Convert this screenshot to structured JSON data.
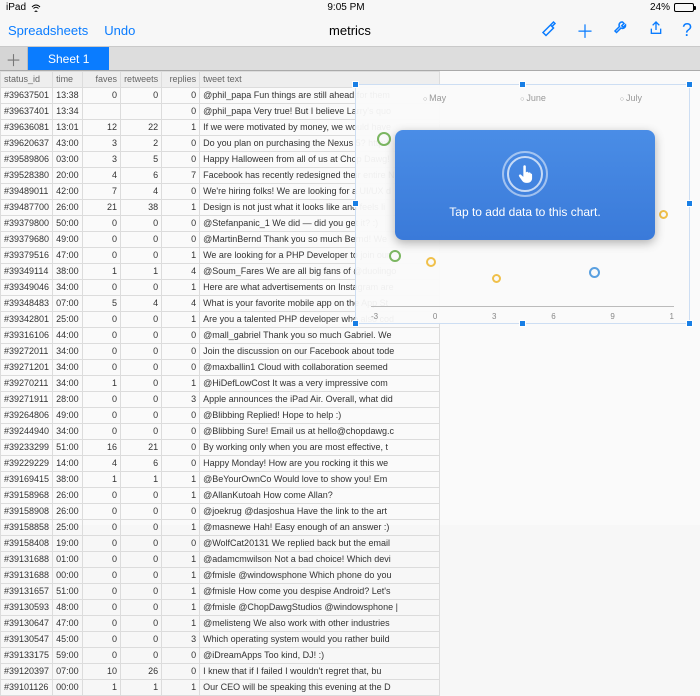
{
  "statusbar": {
    "device": "iPad",
    "time": "9:05 PM",
    "battery": "24%"
  },
  "toolbar": {
    "back": "Spreadsheets",
    "undo": "Undo",
    "title": "metrics"
  },
  "tabs": {
    "sheet1": "Sheet 1"
  },
  "headers": {
    "id": "status_id",
    "time": "time",
    "faves": "faves",
    "retweets": "retweets",
    "replies": "replies",
    "text": "tweet text"
  },
  "rows": [
    {
      "id": "#39637501",
      "time": "13:38",
      "f": "0",
      "r": "0",
      "rp": "0",
      "t": "@phil_papa Fun things are still ahead for them"
    },
    {
      "id": "#39637401",
      "time": "13:34",
      "f": "",
      "r": "",
      "rp": "0",
      "t": "@phil_papa Very true! But I believe Larry's quo"
    },
    {
      "id": "#39636081",
      "time": "13:01",
      "f": "12",
      "r": "22",
      "rp": "1",
      "t": "If we were motivated by money, we would have"
    },
    {
      "id": "#39620637",
      "time": "43:00",
      "f": "3",
      "r": "2",
      "rp": "0",
      "t": "Do you plan on purchasing the Nexus 5? http://"
    },
    {
      "id": "#39589806",
      "time": "03:00",
      "f": "3",
      "r": "5",
      "rp": "0",
      "t": "Happy Halloween from all of us at Chop Dawg!"
    },
    {
      "id": "#39528380",
      "time": "20:00",
      "f": "4",
      "r": "6",
      "rp": "7",
      "t": "Facebook has recently redesigned their entire N"
    },
    {
      "id": "#39489011",
      "time": "42:00",
      "f": "7",
      "r": "4",
      "rp": "0",
      "t": "We're hiring folks! We are looking for a UI/UX d"
    },
    {
      "id": "#39487700",
      "time": "26:00",
      "f": "21",
      "r": "38",
      "rp": "1",
      "t": "Design is not just what it looks like and feels li"
    },
    {
      "id": "#39379800",
      "time": "50:00",
      "f": "0",
      "r": "0",
      "rp": "0",
      "t": "@Stefanpanic_1 We did — did you get it? :)"
    },
    {
      "id": "#39379680",
      "time": "49:00",
      "f": "0",
      "r": "0",
      "rp": "0",
      "t": "@MartinBernd Thank you so much Bernd! We"
    },
    {
      "id": "#39379516",
      "time": "47:00",
      "f": "0",
      "r": "0",
      "rp": "1",
      "t": "We are looking for a PHP Developer to join our"
    },
    {
      "id": "#39349114",
      "time": "38:00",
      "f": "1",
      "r": "1",
      "rp": "4",
      "t": "@Soum_Fares We are all big fans of @duolingo"
    },
    {
      "id": "#39349046",
      "time": "34:00",
      "f": "0",
      "r": "0",
      "rp": "1",
      "t": "Here are what advertisements on Instagram are"
    },
    {
      "id": "#39348483",
      "time": "07:00",
      "f": "5",
      "r": "4",
      "rp": "4",
      "t": "What is your favorite mobile app on the App St"
    },
    {
      "id": "#39342801",
      "time": "25:00",
      "f": "0",
      "r": "0",
      "rp": "1",
      "t": "Are you a talented PHP developer who also cod"
    },
    {
      "id": "#39316106",
      "time": "44:00",
      "f": "0",
      "r": "0",
      "rp": "0",
      "t": "@mall_gabriel Thank you so much Gabriel. We"
    },
    {
      "id": "#39272011",
      "time": "34:00",
      "f": "0",
      "r": "0",
      "rp": "0",
      "t": "Join the discussion on our Facebook about tode"
    },
    {
      "id": "#39271201",
      "time": "34:00",
      "f": "0",
      "r": "0",
      "rp": "0",
      "t": "@maxballin1 Cloud with collaboration seemed"
    },
    {
      "id": "#39270211",
      "time": "34:00",
      "f": "1",
      "r": "0",
      "rp": "1",
      "t": "@HiDefLowCost It was a very impressive com"
    },
    {
      "id": "#39271911",
      "time": "28:00",
      "f": "0",
      "r": "0",
      "rp": "3",
      "t": "Apple announces the iPad Air. Overall, what did"
    },
    {
      "id": "#39264806",
      "time": "49:00",
      "f": "0",
      "r": "0",
      "rp": "0",
      "t": "@Blibbing Replied! Hope to help :)"
    },
    {
      "id": "#39244940",
      "time": "34:00",
      "f": "0",
      "r": "0",
      "rp": "0",
      "t": "@Blibbing Sure! Email us at hello@chopdawg.c"
    },
    {
      "id": "#39233299",
      "time": "51:00",
      "f": "16",
      "r": "21",
      "rp": "0",
      "t": "By working only when you are most effective, t"
    },
    {
      "id": "#39229229",
      "time": "14:00",
      "f": "4",
      "r": "6",
      "rp": "0",
      "t": "Happy Monday! How are you rocking it this we"
    },
    {
      "id": "#39169415",
      "time": "38:00",
      "f": "1",
      "r": "1",
      "rp": "1",
      "t": "@BeYourOwnCo Would love to show you! Em"
    },
    {
      "id": "#39158968",
      "time": "26:00",
      "f": "0",
      "r": "0",
      "rp": "1",
      "t": "@AllanKutoah How come Allan?"
    },
    {
      "id": "#39158908",
      "time": "26:00",
      "f": "0",
      "r": "0",
      "rp": "0",
      "t": "@joekrug @dasjoshua Have the link to the art"
    },
    {
      "id": "#39158858",
      "time": "25:00",
      "f": "0",
      "r": "0",
      "rp": "1",
      "t": "@masnewe Hah! Easy enough of an answer :)"
    },
    {
      "id": "#39158408",
      "time": "19:00",
      "f": "0",
      "r": "0",
      "rp": "0",
      "t": "@WolfCat20131 We replied back but the email"
    },
    {
      "id": "#39131688",
      "time": "01:00",
      "f": "0",
      "r": "0",
      "rp": "1",
      "t": "@adamcmwilson Not a bad choice! Which devi"
    },
    {
      "id": "#39131688",
      "time": "00:00",
      "f": "0",
      "r": "0",
      "rp": "1",
      "t": "@fmisle @windowsphone Which phone do you"
    },
    {
      "id": "#39131657",
      "time": "51:00",
      "f": "0",
      "r": "0",
      "rp": "1",
      "t": "@fmisle How come you despise Android? Let's"
    },
    {
      "id": "#39130593",
      "time": "48:00",
      "f": "0",
      "r": "0",
      "rp": "1",
      "t": "@fmisle @ChopDawgStudios @windowsphone |"
    },
    {
      "id": "#39130647",
      "time": "47:00",
      "f": "0",
      "r": "0",
      "rp": "1",
      "t": "@melisteng We also work with other industries"
    },
    {
      "id": "#39130547",
      "time": "45:00",
      "f": "0",
      "r": "0",
      "rp": "3",
      "t": "Which operating system would you rather build"
    },
    {
      "id": "#39133175",
      "time": "59:00",
      "f": "0",
      "r": "0",
      "rp": "0",
      "t": "@iDreamApps Too kind, DJ! :)"
    },
    {
      "id": "#39120397",
      "time": "07:00",
      "f": "10",
      "r": "26",
      "rp": "0",
      "t": "I knew that if I failed I wouldn't regret that, bu"
    },
    {
      "id": "#39101126",
      "time": "00:00",
      "f": "1",
      "r": "1",
      "rp": "1",
      "t": "Our CEO will be speaking this evening at the D"
    }
  ],
  "chart": {
    "months": [
      "May",
      "June",
      "July"
    ],
    "xticks": [
      "-3",
      "0",
      "3",
      "6",
      "9",
      "1"
    ],
    "tooltip": "Tap to add data to this chart."
  },
  "chart_data": {
    "type": "scatter",
    "title": "",
    "series": [
      {
        "name": "May",
        "color": "#7bb661",
        "points": []
      },
      {
        "name": "June",
        "color": "#f0c04a",
        "points": []
      },
      {
        "name": "July",
        "color": "#5aa0e0",
        "points": []
      }
    ],
    "xlim": [
      -3,
      12
    ],
    "xlabel": "",
    "ylabel": "",
    "note": "empty chart — placeholder bubbles shown, no real data bound"
  }
}
